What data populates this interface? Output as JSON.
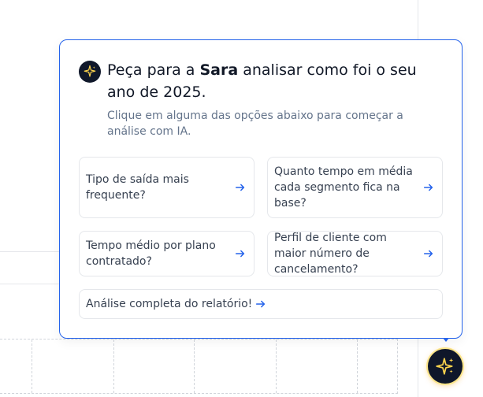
{
  "assistant": {
    "title_prefix": "Peça para a ",
    "name": "Sara",
    "title_suffix": " analisar como foi o seu ano de 2025.",
    "subtitle": "Clique em alguma das opções abaixo para começar a análise com IA.",
    "avatar_icon": "sparkles-icon",
    "accent_color": "#2563eb",
    "avatar_bg": "#0f172a",
    "sparkle_color": "#fcd34d"
  },
  "options": [
    {
      "label": "Tipo de saída mais frequente?",
      "icon": "arrow-right-icon"
    },
    {
      "label": "Quanto tempo em média cada segmento fica na base?",
      "icon": "arrow-right-icon"
    },
    {
      "label": "Tempo médio por plano contratado?",
      "icon": "arrow-right-icon"
    },
    {
      "label": "Perfil de cliente com maior número de cancelamento?",
      "icon": "arrow-right-icon"
    },
    {
      "label": "Análise completa do relatório!",
      "icon": "arrow-right-icon"
    }
  ],
  "fab": {
    "icon": "sparkles-icon"
  }
}
